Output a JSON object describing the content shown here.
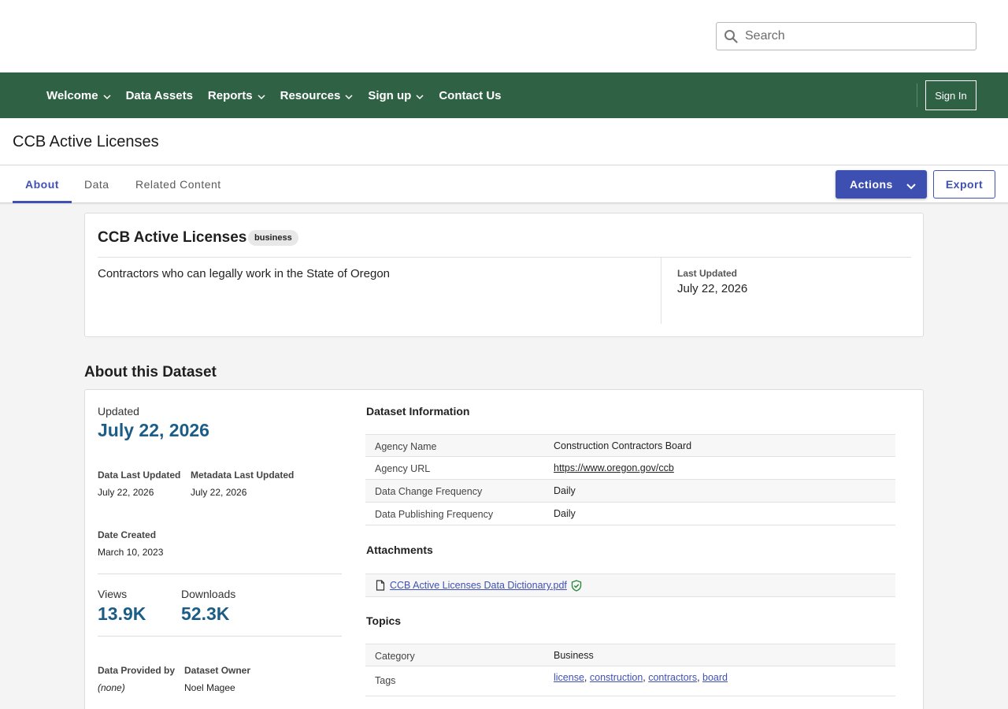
{
  "search": {
    "placeholder": "Search"
  },
  "nav": {
    "items": [
      {
        "label": "Welcome",
        "dropdown": true
      },
      {
        "label": "Data Assets",
        "dropdown": false
      },
      {
        "label": "Reports",
        "dropdown": true
      },
      {
        "label": "Resources",
        "dropdown": true
      },
      {
        "label": "Sign up",
        "dropdown": true
      },
      {
        "label": "Contact Us",
        "dropdown": false
      }
    ],
    "sign_in": "Sign In"
  },
  "page": {
    "title": "CCB Active Licenses"
  },
  "tabs": [
    {
      "label": "About",
      "active": true
    },
    {
      "label": "Data",
      "active": false
    },
    {
      "label": "Related Content",
      "active": false
    }
  ],
  "toolbar": {
    "actions_label": "Actions",
    "export_label": "Export"
  },
  "summary": {
    "title": "CCB Active Licenses",
    "badge": "business",
    "description": "Contractors who can legally work in the State of Oregon",
    "last_updated_label": "Last Updated",
    "last_updated_value": "July 22, 2026"
  },
  "about": {
    "section_title": "About this Dataset",
    "updated_label": "Updated",
    "updated_value": "July 22, 2026",
    "data_last_updated_label": "Data Last Updated",
    "data_last_updated_value": "July 22, 2026",
    "metadata_last_updated_label": "Metadata Last Updated",
    "metadata_last_updated_value": "July 22, 2026",
    "date_created_label": "Date Created",
    "date_created_value": "March 10, 2023",
    "views_label": "Views",
    "views_value": "13.9K",
    "downloads_label": "Downloads",
    "downloads_value": "52.3K",
    "data_provided_by_label": "Data Provided by",
    "data_provided_by_value": "(none)",
    "dataset_owner_label": "Dataset Owner",
    "dataset_owner_value": "Noel Magee"
  },
  "dataset_info": {
    "heading": "Dataset Information",
    "rows": [
      {
        "key": "Agency Name",
        "value": "Construction Contractors Board"
      },
      {
        "key": "Agency URL",
        "value": "https://www.oregon.gov/ccb"
      },
      {
        "key": "Data Change Frequency",
        "value": "Daily"
      },
      {
        "key": "Data Publishing Frequency",
        "value": "Daily"
      }
    ]
  },
  "attachments": {
    "heading": "Attachments",
    "file_name": "CCB Active Licenses Data Dictionary.pdf"
  },
  "topics": {
    "heading": "Topics",
    "category_label": "Category",
    "category_value": "Business",
    "tags_label": "Tags",
    "tags": [
      "license",
      "construction",
      "contractors",
      "board"
    ]
  },
  "colors": {
    "nav_green": "#2f6144",
    "accent_blue": "#3f51b5",
    "stat_blue": "#1c5d86"
  }
}
